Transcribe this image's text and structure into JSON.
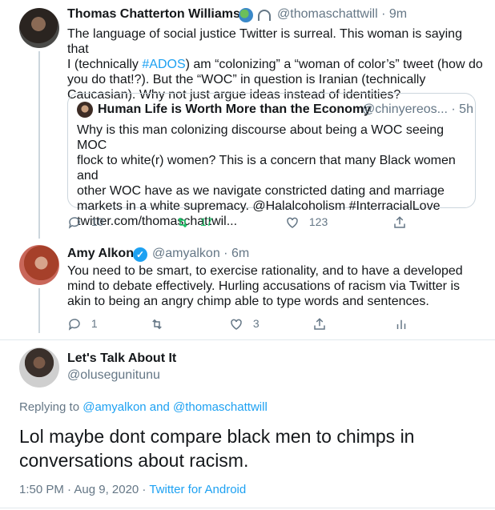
{
  "tweet1": {
    "name": "Thomas Chatterton Williams",
    "handle": "@thomaschattwill",
    "time": "9m",
    "lines": [
      "The language of social justice Twitter is surreal. This woman is saying that",
      "I (technically ",
      "#ADOS",
      ") am “colonizing” a “woman of color’s” tweet (how do",
      "you do that!?). But the “WOC” in question is Iranian (technically",
      "Caucasian). Why not just argue ideas instead of identities?"
    ],
    "quote": {
      "name": "Human Life is Worth More than the Economy",
      "handle": "@chinyereos...",
      "time": "5h",
      "lines": [
        "Why is this man colonizing discourse about being a WOC seeing MOC",
        "flock to white(r) women? This is a concern that many Black women and",
        "other WOC have as we navigate constricted dating and marriage",
        "markets in a white supremacy. @Halalcoholism #InterracialLove",
        "twitter.com/thomaschattwil..."
      ]
    },
    "actions": {
      "reply": "10",
      "retweet": "17",
      "like": "123"
    }
  },
  "tweet2": {
    "name": "Amy Alkon",
    "handle": "@amyalkon",
    "time": "6m",
    "lines": [
      "You need to be smart, to exercise rationality, and to have a developed",
      "mind to debate effectively. Hurling accusations of racism via Twitter is",
      "akin to being an angry chimp able to type words and sentences."
    ],
    "actions": {
      "reply": "1",
      "like": "3"
    }
  },
  "main": {
    "name": "Let's Talk About It",
    "handle": "@olusegunitunu",
    "replying_prefix": "Replying to ",
    "replying_to": "@amyalkon and @thomaschattwill",
    "text_lines": [
      "Lol maybe dont compare black men to chimps in",
      "conversations about racism."
    ],
    "time": "1:50 PM · Aug 9, 2020 · ",
    "source": "Twitter for Android"
  },
  "colors": {
    "accent": "#1da1f2",
    "retweet": "#17bf63",
    "muted": "#657786"
  },
  "icons": [
    "reply-icon",
    "retweet-icon",
    "like-icon",
    "share-icon",
    "analytics-icon",
    "verified-icon",
    "globe-icon",
    "headphones-icon"
  ]
}
